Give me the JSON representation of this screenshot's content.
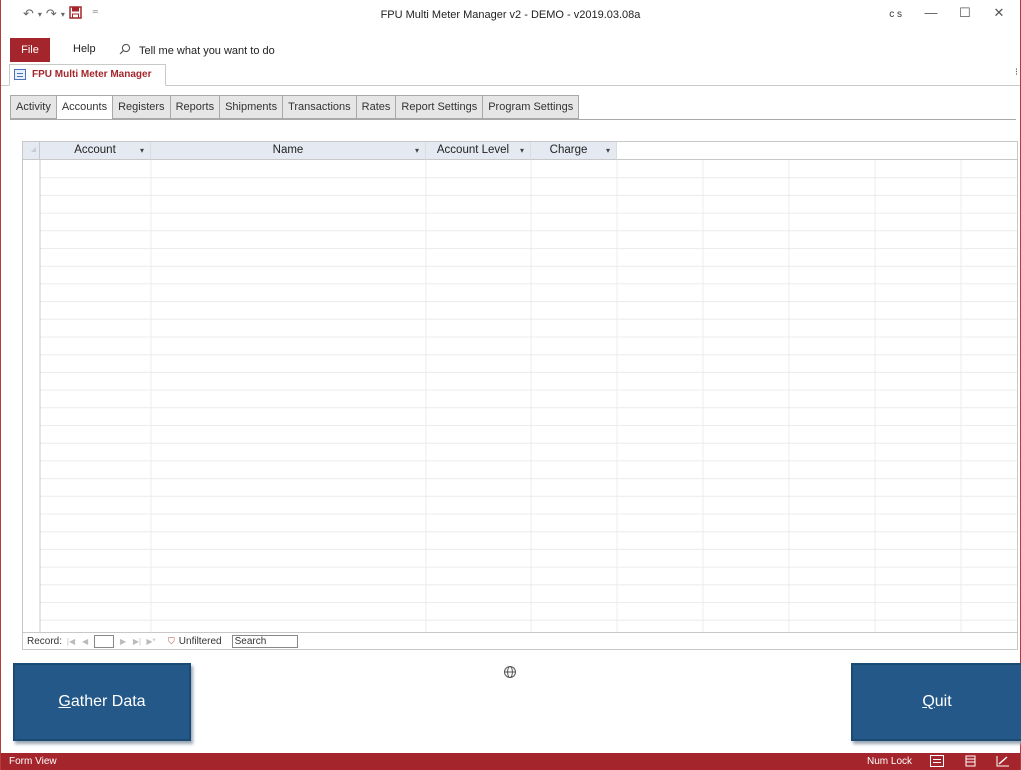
{
  "window": {
    "title": "FPU Multi Meter Manager v2 - DEMO - v2019.03.08a",
    "user_initials": "c s",
    "minimize_glyph": "—",
    "maximize_glyph": "☐",
    "close_glyph": "✕"
  },
  "quick_access": {
    "undo_glyph": "↶",
    "redo_glyph": "↷",
    "save_icon": "save-icon",
    "customize_glyph": "⁼"
  },
  "ribbon": {
    "file_label": "File",
    "help_label": "Help",
    "tell_me_placeholder": "Tell me what you want to do"
  },
  "document_tab": {
    "label": "FPU Multi Meter Manager"
  },
  "form_tabs": [
    {
      "label": "Activity",
      "active": false
    },
    {
      "label": "Accounts",
      "active": true
    },
    {
      "label": "Registers",
      "active": false
    },
    {
      "label": "Reports",
      "active": false
    },
    {
      "label": "Shipments",
      "active": false
    },
    {
      "label": "Transactions",
      "active": false
    },
    {
      "label": "Rates",
      "active": false
    },
    {
      "label": "Report Settings",
      "active": false
    },
    {
      "label": "Program Settings",
      "active": false
    }
  ],
  "datasheet": {
    "columns": [
      {
        "label": "Account",
        "has_dropdown": true
      },
      {
        "label": "Name",
        "has_dropdown": true
      },
      {
        "label": "Account Level",
        "has_dropdown": true
      },
      {
        "label": "Charge",
        "has_dropdown": true
      }
    ],
    "rows": []
  },
  "navigation": {
    "record_label": "Record:",
    "current_record": "",
    "filter_label": "Unfiltered",
    "search_label": "Search"
  },
  "buttons": {
    "gather_prefix": "G",
    "gather_rest": "ather Data",
    "quit_prefix": "Q",
    "quit_rest": "uit"
  },
  "status": {
    "view": "Form View",
    "num_lock": "Num Lock"
  },
  "colors": {
    "brand": "#a4262c",
    "button": "#245889"
  }
}
